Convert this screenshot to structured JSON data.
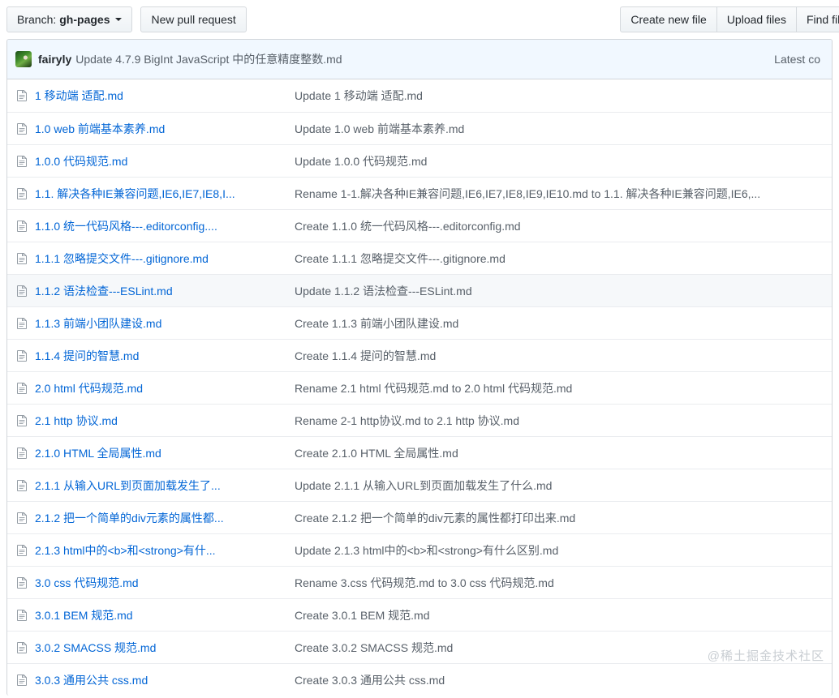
{
  "toolbar": {
    "branch_label": "Branch:",
    "branch_name": "gh-pages",
    "new_pull_request_label": "New pull request",
    "create_new_file_label": "Create new file",
    "upload_files_label": "Upload files",
    "find_file_label": "Find file"
  },
  "commit_header": {
    "author": "fairyly",
    "message": "Update 4.7.9 BigInt JavaScript 中的任意精度整数.md",
    "latest_commit_label": "Latest co"
  },
  "files": [
    {
      "name": "1 移动端 适配.md",
      "message": "Update 1 移动端 适配.md",
      "hovered": false
    },
    {
      "name": "1.0 web 前端基本素养.md",
      "message": "Update 1.0 web 前端基本素养.md",
      "hovered": false
    },
    {
      "name": "1.0.0 代码规范.md",
      "message": "Update 1.0.0 代码规范.md",
      "hovered": false
    },
    {
      "name": "1.1. 解决各种IE兼容问题,IE6,IE7,IE8,I...",
      "message": "Rename 1-1.解决各种IE兼容问题,IE6,IE7,IE8,IE9,IE10.md to 1.1. 解决各种IE兼容问题,IE6,...",
      "hovered": false
    },
    {
      "name": "1.1.0 统一代码风格---.editorconfig....",
      "message": "Create 1.1.0 统一代码风格---.editorconfig.md",
      "hovered": false
    },
    {
      "name": "1.1.1 忽略提交文件---.gitignore.md",
      "message": "Create 1.1.1 忽略提交文件---.gitignore.md",
      "hovered": false
    },
    {
      "name": "1.1.2 语法检查---ESLint.md",
      "message": "Update 1.1.2 语法检查---ESLint.md",
      "hovered": true
    },
    {
      "name": "1.1.3 前端小团队建设.md",
      "message": "Create 1.1.3 前端小团队建设.md",
      "hovered": false
    },
    {
      "name": "1.1.4 提问的智慧.md",
      "message": "Create 1.1.4 提问的智慧.md",
      "hovered": false
    },
    {
      "name": "2.0 html 代码规范.md",
      "message": "Rename 2.1 html 代码规范.md to 2.0 html 代码规范.md",
      "hovered": false
    },
    {
      "name": "2.1 http 协议.md",
      "message": "Rename 2-1 http协议.md to 2.1 http 协议.md",
      "hovered": false
    },
    {
      "name": "2.1.0 HTML 全局属性.md",
      "message": "Create 2.1.0 HTML 全局属性.md",
      "hovered": false
    },
    {
      "name": "2.1.1 从输入URL到页面加载发生了...",
      "message": "Update 2.1.1 从输入URL到页面加载发生了什么.md",
      "hovered": false
    },
    {
      "name": "2.1.2 把一个简单的div元素的属性都...",
      "message": "Create 2.1.2 把一个简单的div元素的属性都打印出来.md",
      "hovered": false
    },
    {
      "name": "2.1.3 html中的<b>和<strong>有什...",
      "message": "Update 2.1.3 html中的<b>和<strong>有什么区别.md",
      "hovered": false
    },
    {
      "name": "3.0 css 代码规范.md",
      "message": "Rename 3.css 代码规范.md to 3.0 css 代码规范.md",
      "hovered": false
    },
    {
      "name": "3.0.1 BEM 规范.md",
      "message": "Create 3.0.1 BEM 规范.md",
      "hovered": false
    },
    {
      "name": "3.0.2 SMACSS 规范.md",
      "message": "Create 3.0.2 SMACSS 规范.md",
      "hovered": false
    },
    {
      "name": "3.0.3 通用公共 css.md",
      "message": "Create 3.0.3 通用公共 css.md",
      "hovered": false
    }
  ],
  "watermark": {
    "text": "@稀土掘金技术社区"
  },
  "colors": {
    "link": "#0366d6",
    "muted": "#586069",
    "header_band": "#f1f8ff",
    "row_hover": "#f6f8fa",
    "border": "#d1d5da"
  }
}
